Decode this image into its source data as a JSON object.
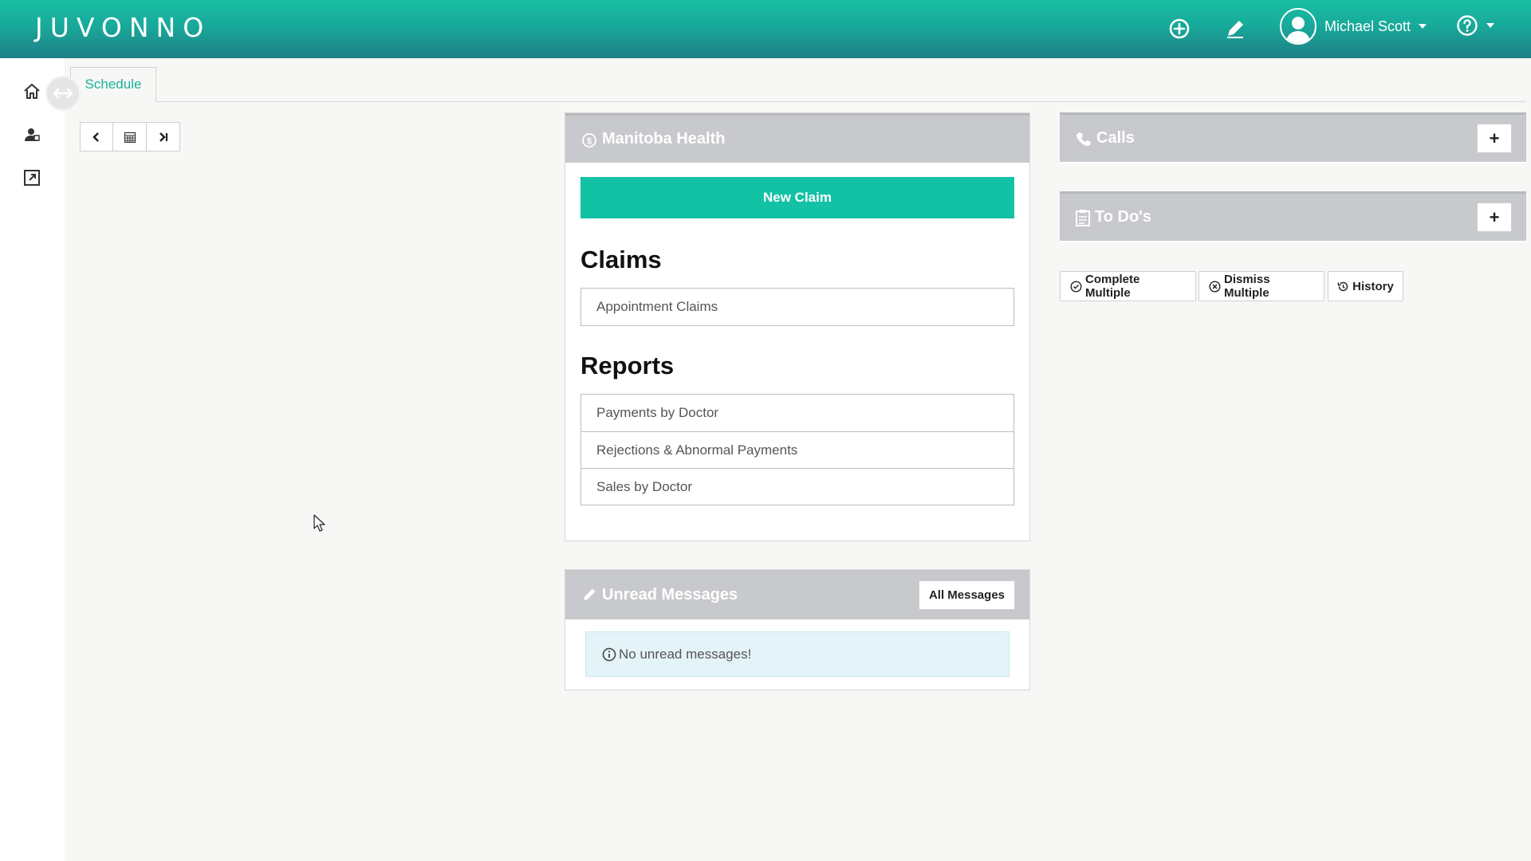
{
  "header": {
    "logo_text": "JUVONNO",
    "add_icon": "plus-circle-icon",
    "compose_icon": "pencil-icon",
    "user_name": "Michael Scott",
    "help_icon": "question-circle-icon",
    "brand_color": "#17bfa3"
  },
  "sidebar": {
    "items": [
      {
        "icon": "home-icon"
      },
      {
        "icon": "patients-icon"
      },
      {
        "icon": "external-link-icon"
      }
    ]
  },
  "tabs": {
    "active": "Schedule"
  },
  "schedule_nav": {
    "prev_icon": "chevron-left-icon",
    "calendar_icon": "calendar-icon",
    "today_icon": "skip-forward-icon"
  },
  "manitoba": {
    "title": "Manitoba Health",
    "new_claim_label": "New Claim",
    "claims_title": "Claims",
    "claims_items": [
      "Appointment Claims"
    ],
    "reports_title": "Reports",
    "reports_items": [
      "Payments by Doctor",
      "Rejections & Abnormal Payments",
      "Sales by Doctor"
    ]
  },
  "messages": {
    "title": "Unread Messages",
    "all_messages_label": "All Messages",
    "empty_text": "No unread messages!"
  },
  "calls": {
    "title": "Calls",
    "add_label": "+"
  },
  "todos": {
    "title": "To Do's",
    "add_label": "+",
    "complete_multiple_label": "Complete Multiple",
    "dismiss_multiple_label": "Dismiss Multiple",
    "history_label": "History"
  }
}
